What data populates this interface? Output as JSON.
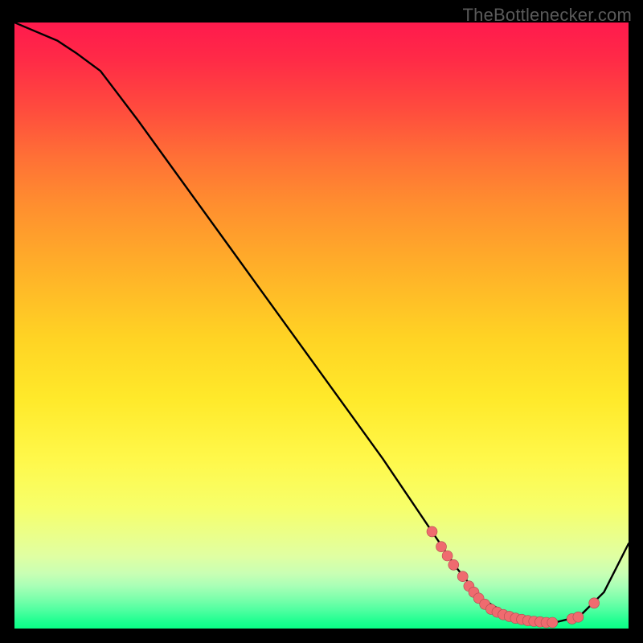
{
  "watermark": "TheBottlenecker.com",
  "colors": {
    "line": "#000000",
    "dot_fill": "#ef6b6f",
    "dot_stroke": "#b24a50"
  },
  "chart_data": {
    "type": "line",
    "title": "",
    "xlabel": "",
    "ylabel": "",
    "xlim": [
      0,
      100
    ],
    "ylim": [
      0,
      100
    ],
    "series": [
      {
        "name": "curve",
        "x": [
          0,
          7,
          10,
          14,
          20,
          30,
          40,
          50,
          60,
          68,
          72,
          76,
          80,
          84,
          88,
          92,
          96,
          100
        ],
        "y": [
          100,
          97,
          95,
          92,
          84,
          70,
          56,
          42,
          28,
          16,
          10,
          5,
          2.5,
          1.2,
          1.0,
          2.0,
          6.0,
          14
        ]
      }
    ],
    "markers": [
      {
        "x": 68.0,
        "y": 16.0
      },
      {
        "x": 69.5,
        "y": 13.5
      },
      {
        "x": 70.5,
        "y": 12.0
      },
      {
        "x": 71.5,
        "y": 10.5
      },
      {
        "x": 73.0,
        "y": 8.6
      },
      {
        "x": 74.0,
        "y": 7.0
      },
      {
        "x": 74.8,
        "y": 6.0
      },
      {
        "x": 75.6,
        "y": 5.0
      },
      {
        "x": 76.6,
        "y": 4.0
      },
      {
        "x": 77.6,
        "y": 3.2
      },
      {
        "x": 78.6,
        "y": 2.7
      },
      {
        "x": 79.6,
        "y": 2.3
      },
      {
        "x": 80.6,
        "y": 2.0
      },
      {
        "x": 81.6,
        "y": 1.7
      },
      {
        "x": 82.6,
        "y": 1.5
      },
      {
        "x": 83.6,
        "y": 1.3
      },
      {
        "x": 84.6,
        "y": 1.2
      },
      {
        "x": 85.6,
        "y": 1.1
      },
      {
        "x": 86.6,
        "y": 1.0
      },
      {
        "x": 87.6,
        "y": 1.0
      },
      {
        "x": 90.8,
        "y": 1.6
      },
      {
        "x": 91.8,
        "y": 1.9
      },
      {
        "x": 94.4,
        "y": 4.2
      }
    ]
  }
}
